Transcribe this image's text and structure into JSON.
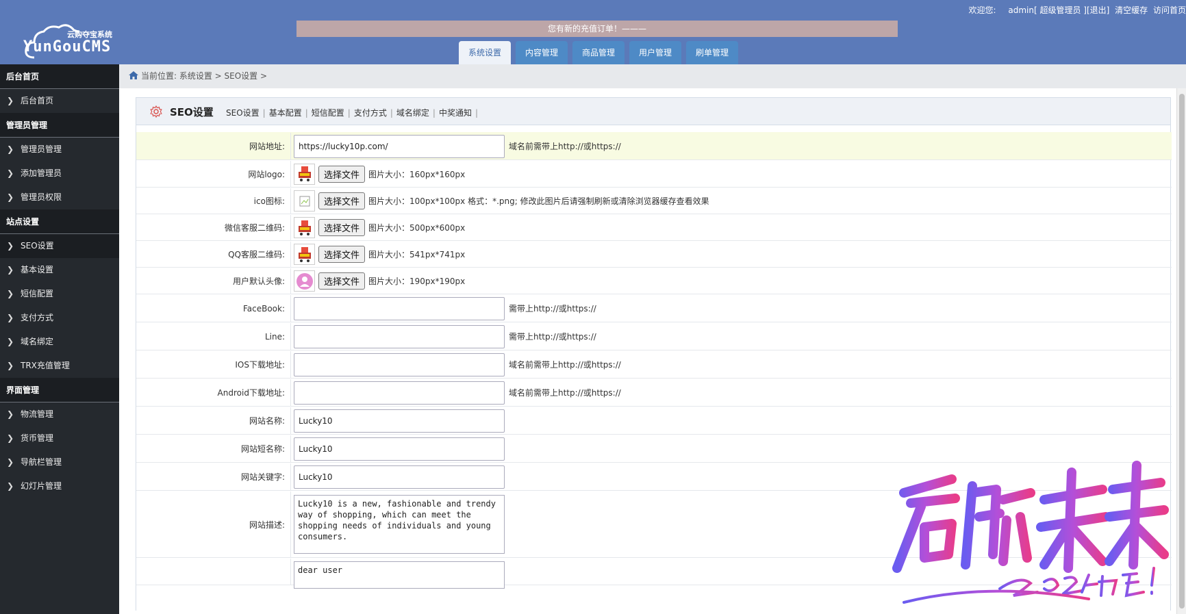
{
  "header": {
    "logo_sub": "云购夺宝系统",
    "logo_main": "YunGouCMS",
    "notice": "您有新的充值订单！———",
    "welcome": "欢迎您:",
    "user": "admin[ 超级管理员 ]",
    "logout": "[退出]",
    "clear_cache": "清空缓存",
    "visit_home": "访问首页",
    "tabs": [
      {
        "label": "系统设置",
        "active": true
      },
      {
        "label": "内容管理",
        "active": false
      },
      {
        "label": "商品管理",
        "active": false
      },
      {
        "label": "用户管理",
        "active": false
      },
      {
        "label": "刷单管理",
        "active": false
      }
    ]
  },
  "sidebar": {
    "groups": [
      {
        "title": "后台首页",
        "items": [
          "后台首页"
        ]
      },
      {
        "title": "管理员管理",
        "items": [
          "管理员管理",
          "添加管理员",
          "管理员权限"
        ]
      },
      {
        "title": "站点设置",
        "items": [
          "SEO设置",
          "基本设置",
          "短信配置",
          "支付方式",
          "域名绑定",
          "TRX充值管理"
        ]
      },
      {
        "title": "界面管理",
        "items": [
          "物流管理",
          "货币管理",
          "导航栏管理",
          "幻灯片管理"
        ]
      }
    ],
    "active_item": "SEO设置"
  },
  "breadcrumb": "当前位置: 系统设置 > SEO设置 >",
  "panel": {
    "title": "SEO设置",
    "links": [
      "SEO设置",
      "基本配置",
      "短信配置",
      "支付方式",
      "域名绑定",
      "中奖通知"
    ]
  },
  "form": {
    "file_button": "选择文件",
    "site_url": {
      "label": "网站地址:",
      "value": "https://lucky10p.com/",
      "hint": "域名前需带上http://或https://"
    },
    "logo": {
      "label": "网站logo:",
      "hint": "图片大小：160px*160px"
    },
    "ico": {
      "label": "ico图标:",
      "hint": "图片大小：100px*100px  格式：*.png; 修改此图片后请强制刷新或清除浏览器缓存查看效果"
    },
    "wechat_qr": {
      "label": "微信客服二维码:",
      "hint": "图片大小：500px*600px"
    },
    "qq_qr": {
      "label": "QQ客服二维码:",
      "hint": "图片大小：541px*741px"
    },
    "avatar": {
      "label": "用户默认头像:",
      "hint": "图片大小：190px*190px"
    },
    "facebook": {
      "label": "FaceBook:",
      "value": "",
      "hint": "需带上http://或https://"
    },
    "line": {
      "label": "Line:",
      "value": "",
      "hint": "需带上http://或https://"
    },
    "ios": {
      "label": "IOS下载地址:",
      "value": "",
      "hint": "域名前需带上http://或https://"
    },
    "android": {
      "label": "Android下载地址:",
      "value": "",
      "hint": "域名前需带上http://或https://"
    },
    "site_name": {
      "label": "网站名称:",
      "value": "Lucky10"
    },
    "short_name": {
      "label": "网站短名称:",
      "value": "Lucky10"
    },
    "keywords": {
      "label": "网站关键字:",
      "value": "Lucky10"
    },
    "description": {
      "label": "网站描述:",
      "value": "Lucky10 is a new, fashionable and trendy way of shopping, which can meet the shopping needs of individuals and young consumers."
    },
    "next_textarea": {
      "value": "dear user"
    }
  },
  "colors": {
    "header_bg": "#5b7ab9",
    "tab_bg": "#4e8ac6",
    "sidebar_bg": "#25292e",
    "highlight_row": "#f8fbe2",
    "notice_bg": "#bda6a8"
  }
}
